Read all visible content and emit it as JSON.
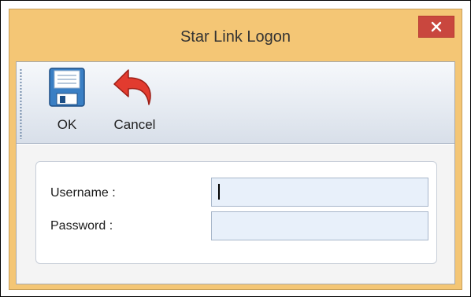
{
  "window": {
    "title": "Star Link Logon",
    "close_icon": "close-icon"
  },
  "toolbar": {
    "ok_label": "OK",
    "ok_icon": "save-disk-icon",
    "cancel_label": "Cancel",
    "cancel_icon": "undo-arrow-icon"
  },
  "form": {
    "username_label": "Username :",
    "username_value": "",
    "password_label": "Password :",
    "password_value": ""
  },
  "colors": {
    "title_bar": "#f4c675",
    "close_button": "#c9473e",
    "field_background": "#e8f0fa",
    "cancel_arrow": "#e23b2f"
  }
}
